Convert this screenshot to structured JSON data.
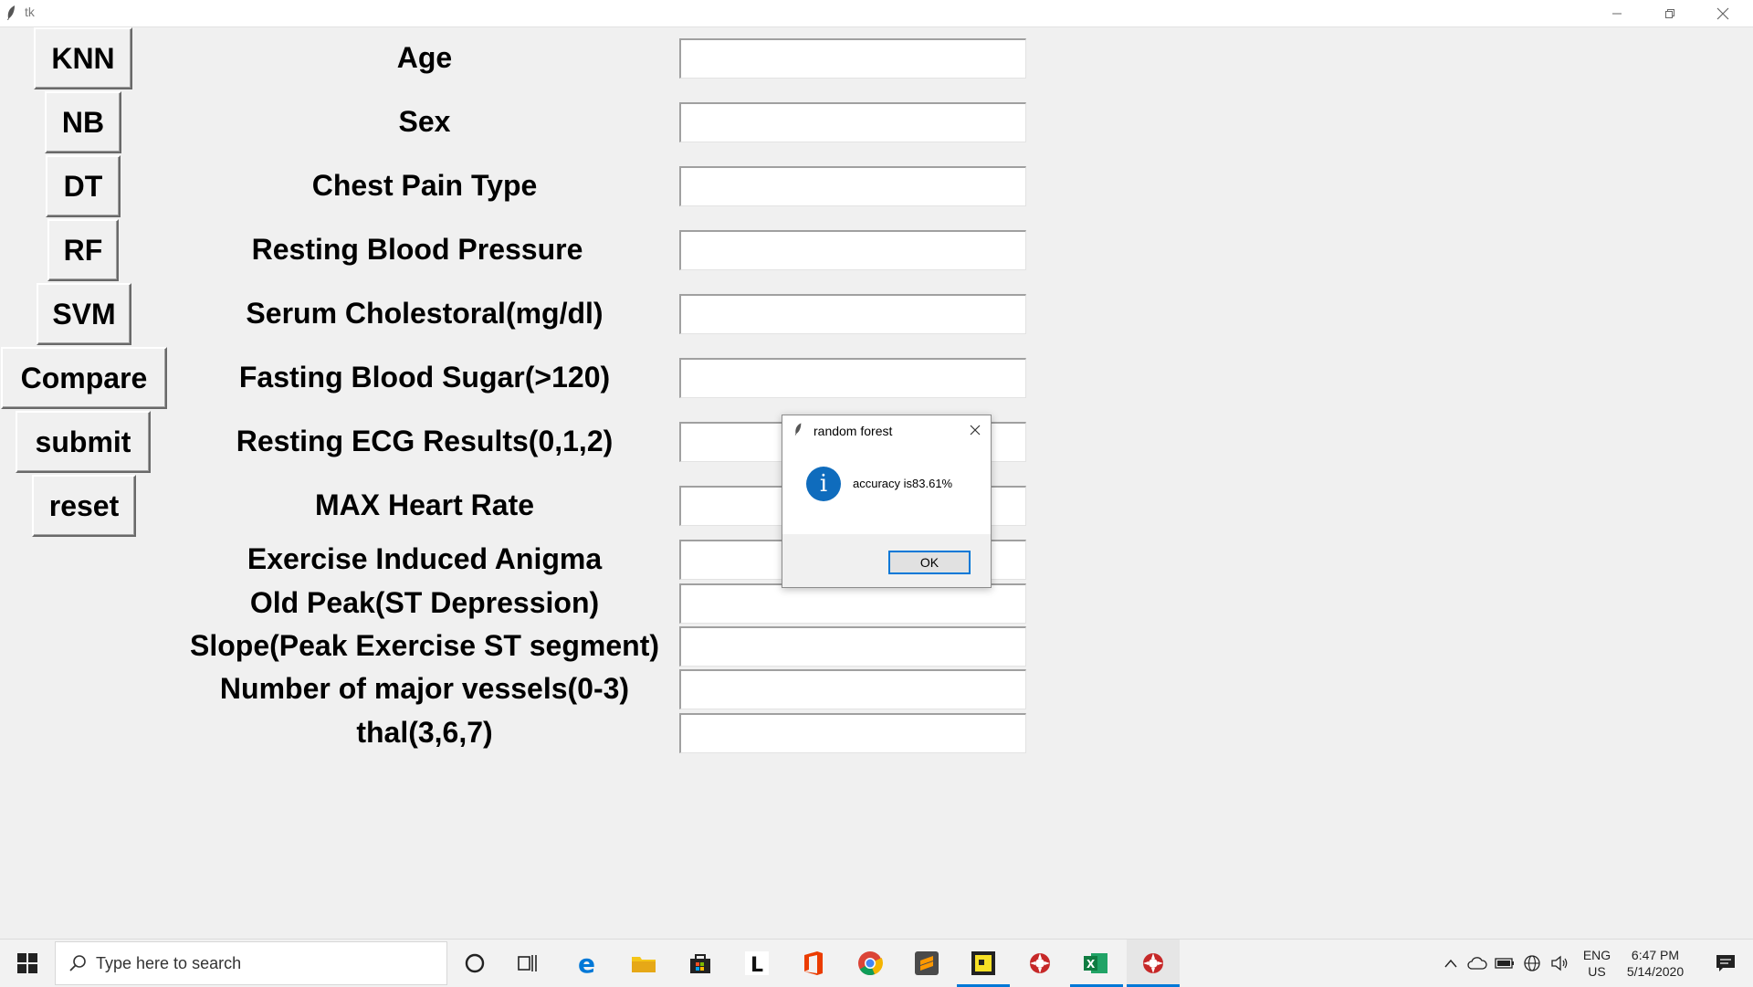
{
  "window": {
    "title": "tk"
  },
  "buttons": {
    "knn": "KNN",
    "nb": "NB",
    "dt": "DT",
    "rf": "RF",
    "svm": "SVM",
    "compare": "Compare",
    "submit": "submit",
    "reset": "reset"
  },
  "fields": [
    {
      "label": "Age",
      "value": ""
    },
    {
      "label": "Sex",
      "value": ""
    },
    {
      "label": "Chest Pain Type",
      "value": ""
    },
    {
      "label": "Resting Blood Pressure",
      "value": ""
    },
    {
      "label": "Serum Cholestoral(mg/dl)",
      "value": ""
    },
    {
      "label": "Fasting Blood Sugar(>120)",
      "value": ""
    },
    {
      "label": "Resting ECG Results(0,1,2)",
      "value": ""
    },
    {
      "label": "MAX Heart Rate",
      "value": ""
    },
    {
      "label": "Exercise Induced Anigma",
      "value": ""
    },
    {
      "label": "Old Peak(ST Depression)",
      "value": ""
    },
    {
      "label": "Slope(Peak Exercise ST segment)",
      "value": ""
    },
    {
      "label": "Number of major vessels(0-3)",
      "value": ""
    },
    {
      "label": "thal(3,6,7)",
      "value": ""
    }
  ],
  "dialog": {
    "title": "random forest",
    "message": "accuracy is83.61%",
    "ok_label": "OK",
    "icon": "info-icon"
  },
  "taskbar": {
    "search_placeholder": "Type here to search",
    "apps": [
      "cortana-icon",
      "task-view-icon",
      "edge-icon",
      "file-explorer-icon",
      "store-icon",
      "l-app-icon",
      "office-icon",
      "chrome-icon",
      "sublime-icon",
      "sticky-app-icon",
      "python-icon",
      "excel-icon",
      "python-icon"
    ],
    "lang_line1": "ENG",
    "lang_line2": "US",
    "time": "6:47 PM",
    "date": "5/14/2020"
  },
  "colors": {
    "accent": "#0078d7",
    "info": "#0f6cbd",
    "background": "#f0f0f0"
  }
}
